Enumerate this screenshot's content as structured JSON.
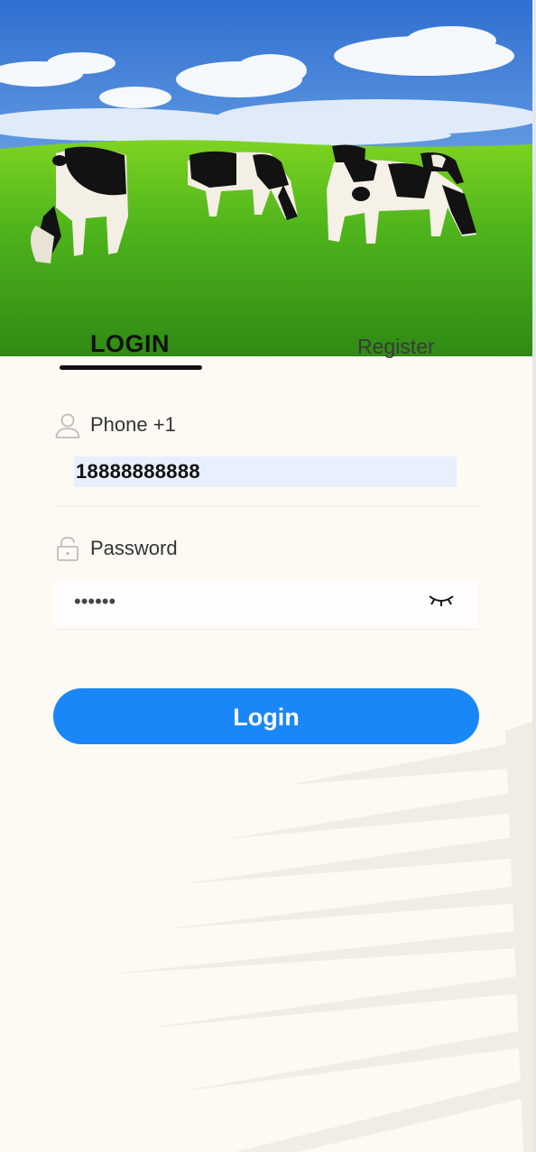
{
  "tabs": {
    "login_label": "LOGIN",
    "register_label": "Register"
  },
  "phone": {
    "label": "Phone +1",
    "value": "18888888888"
  },
  "password": {
    "label": "Password",
    "masked_value": "••••••"
  },
  "actions": {
    "login_label": "Login"
  },
  "icons": {
    "user": "user-outline-icon",
    "lock": "lock-outline-icon",
    "eye": "eye-closed-icon"
  },
  "colors": {
    "accent": "#1a87f8",
    "background": "#fdfaf4",
    "input_fill": "#e8f0fe"
  }
}
